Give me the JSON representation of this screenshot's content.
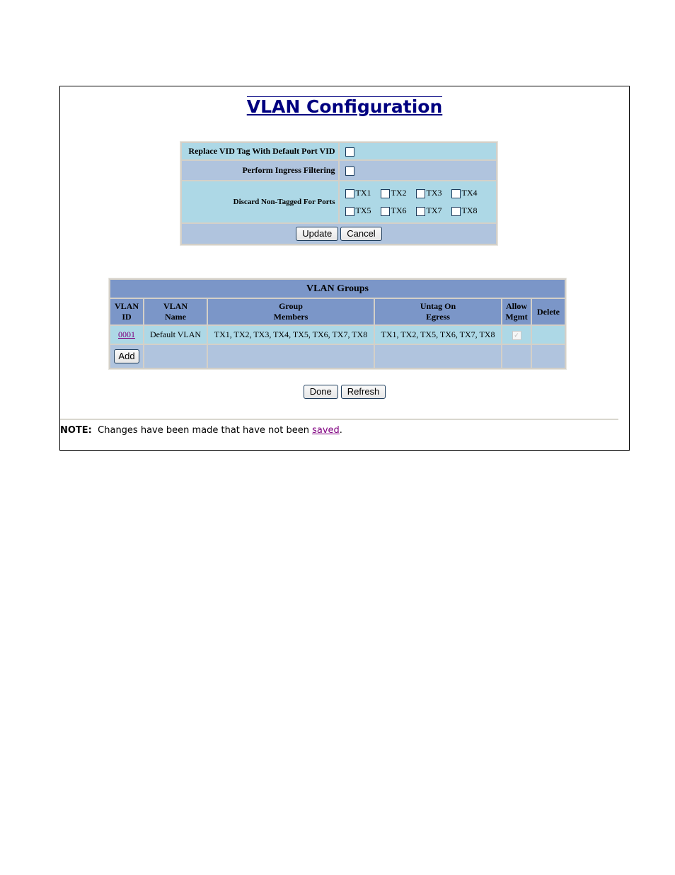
{
  "page": {
    "title": "VLAN Configuration"
  },
  "config": {
    "replace_vid": {
      "label": "Replace VID Tag With Default Port VID",
      "checked": false
    },
    "ingress": {
      "label": "Perform Ingress Filtering",
      "checked": false
    },
    "discard": {
      "label": "Discard Non-Tagged For Ports",
      "ports": [
        {
          "label": "TX1",
          "checked": false
        },
        {
          "label": "TX2",
          "checked": false
        },
        {
          "label": "TX3",
          "checked": false
        },
        {
          "label": "TX4",
          "checked": false
        },
        {
          "label": "TX5",
          "checked": false
        },
        {
          "label": "TX6",
          "checked": false
        },
        {
          "label": "TX7",
          "checked": false
        },
        {
          "label": "TX8",
          "checked": false
        }
      ]
    },
    "update_label": "Update",
    "cancel_label": "Cancel"
  },
  "groups": {
    "caption": "VLAN Groups",
    "headers": {
      "vlan_id": [
        "VLAN",
        "ID"
      ],
      "vlan_name": [
        "VLAN",
        "Name"
      ],
      "members": [
        "Group",
        "Members"
      ],
      "untag": [
        "Untag On",
        "Egress"
      ],
      "mgmt": [
        "Allow",
        "Mgmt"
      ],
      "delete": "Delete"
    },
    "rows": [
      {
        "id": "0001",
        "name": "Default VLAN",
        "members": "TX1, TX2, TX3, TX4, TX5, TX6, TX7, TX8",
        "untag": "TX1, TX2, TX5, TX6, TX7, TX8",
        "allow_mgmt": true,
        "delete": ""
      }
    ],
    "add_label": "Add"
  },
  "actions": {
    "done_label": "Done",
    "refresh_label": "Refresh"
  },
  "note": {
    "prefix": "NOTE:",
    "text": "Changes have been made that have not been",
    "link": "saved",
    "suffix": "."
  }
}
